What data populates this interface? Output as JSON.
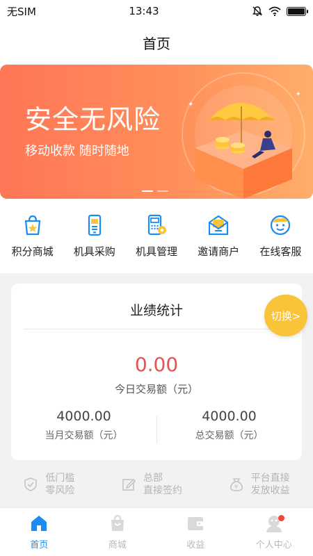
{
  "status": {
    "carrier": "无SIM",
    "time": "13:43"
  },
  "nav": {
    "title": "首页"
  },
  "banner": {
    "title": "安全无风险",
    "subtitle": "移动收款 随时随地",
    "slides": 2,
    "active_slide": 0
  },
  "menu": [
    {
      "label": "积分商城",
      "icon": "shopping-bag-icon"
    },
    {
      "label": "机具采购",
      "icon": "phone-device-icon"
    },
    {
      "label": "机具管理",
      "icon": "pos-terminal-icon"
    },
    {
      "label": "邀请商户",
      "icon": "invite-mail-icon"
    },
    {
      "label": "在线客服",
      "icon": "service-face-icon"
    }
  ],
  "stats": {
    "title": "业绩统计",
    "switch_label": "切换>",
    "today_value": "0.00",
    "today_label": "今日交易额（元）",
    "month_value": "4000.00",
    "month_label": "当月交易额（元）",
    "total_value": "4000.00",
    "total_label": "总交易额（元）"
  },
  "features": [
    {
      "line1": "低门槛",
      "line2": "零风险",
      "icon": "shield-icon"
    },
    {
      "line1": "总部",
      "line2": "直接签约",
      "icon": "edit-icon"
    },
    {
      "line1": "平台直接",
      "line2": "发放收益",
      "icon": "money-bag-icon"
    }
  ],
  "tabs": [
    {
      "label": "首页",
      "icon": "home-icon",
      "active": true
    },
    {
      "label": "商城",
      "icon": "shop-bag-icon",
      "active": false
    },
    {
      "label": "收益",
      "icon": "wallet-icon",
      "active": false
    },
    {
      "label": "个人中心",
      "icon": "profile-icon",
      "active": false,
      "badge": true
    }
  ],
  "colors": {
    "accent": "#1b8cf2",
    "banner_start": "#ff7656",
    "banner_end": "#ffae6a",
    "today_value": "#e55353",
    "switch": "#f9c43a"
  }
}
